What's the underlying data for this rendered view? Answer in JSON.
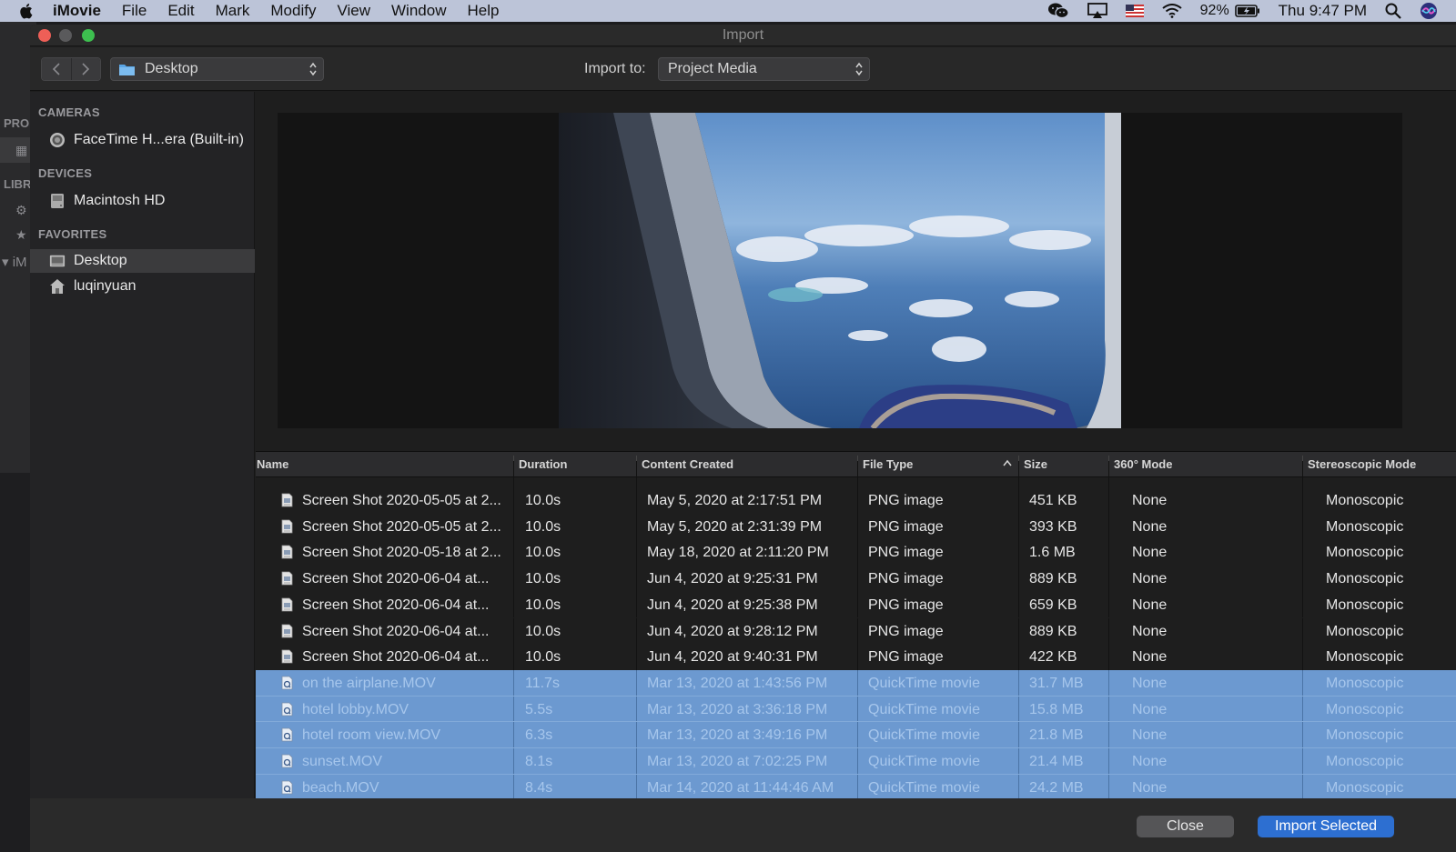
{
  "menubar": {
    "app_name": "iMovie",
    "menus": [
      "File",
      "Edit",
      "Mark",
      "Modify",
      "View",
      "Window",
      "Help"
    ],
    "battery": "92%",
    "clock": "Thu 9:47 PM"
  },
  "background_window": {
    "labels": [
      "PRO",
      "LIBR",
      "iM"
    ]
  },
  "window": {
    "title": "Import"
  },
  "toolbar": {
    "location": "Desktop",
    "import_to_label": "Import to:",
    "import_to_value": "Project Media"
  },
  "sidebar": {
    "cameras_header": "CAMERAS",
    "camera": "FaceTime H...era (Built-in)",
    "devices_header": "DEVICES",
    "device": "Macintosh HD",
    "favorites_header": "FAVORITES",
    "favorites": [
      "Desktop",
      "luqinyuan"
    ]
  },
  "preview": {
    "icon": "airplane-window-photo"
  },
  "table": {
    "columns": {
      "name": "Name",
      "duration": "Duration",
      "content_created": "Content Created",
      "file_type": "File Type",
      "size": "Size",
      "mode_360": "360° Mode",
      "stereo": "Stereoscopic Mode"
    },
    "rows": [
      {
        "name": "Screen Shot 2020-05-05 at 2...",
        "duration": "10.0s",
        "created": "May 5, 2020 at 2:17:51 PM",
        "type": "PNG image",
        "size": "451 KB",
        "mode360": "None",
        "stereo": "Monoscopic",
        "selected": false,
        "kind": "image"
      },
      {
        "name": "Screen Shot 2020-05-05 at 2...",
        "duration": "10.0s",
        "created": "May 5, 2020 at 2:31:39 PM",
        "type": "PNG image",
        "size": "393 KB",
        "mode360": "None",
        "stereo": "Monoscopic",
        "selected": false,
        "kind": "image"
      },
      {
        "name": "Screen Shot 2020-05-18 at 2...",
        "duration": "10.0s",
        "created": "May 18, 2020 at 2:11:20 PM",
        "type": "PNG image",
        "size": "1.6 MB",
        "mode360": "None",
        "stereo": "Monoscopic",
        "selected": false,
        "kind": "image"
      },
      {
        "name": "Screen Shot 2020-06-04 at...",
        "duration": "10.0s",
        "created": "Jun 4, 2020 at 9:25:31 PM",
        "type": "PNG image",
        "size": "889 KB",
        "mode360": "None",
        "stereo": "Monoscopic",
        "selected": false,
        "kind": "image"
      },
      {
        "name": "Screen Shot 2020-06-04 at...",
        "duration": "10.0s",
        "created": "Jun 4, 2020 at 9:25:38 PM",
        "type": "PNG image",
        "size": "659 KB",
        "mode360": "None",
        "stereo": "Monoscopic",
        "selected": false,
        "kind": "image"
      },
      {
        "name": "Screen Shot 2020-06-04 at...",
        "duration": "10.0s",
        "created": "Jun 4, 2020 at 9:28:12 PM",
        "type": "PNG image",
        "size": "889 KB",
        "mode360": "None",
        "stereo": "Monoscopic",
        "selected": false,
        "kind": "image"
      },
      {
        "name": "Screen Shot 2020-06-04 at...",
        "duration": "10.0s",
        "created": "Jun 4, 2020 at 9:40:31 PM",
        "type": "PNG image",
        "size": "422 KB",
        "mode360": "None",
        "stereo": "Monoscopic",
        "selected": false,
        "kind": "image"
      },
      {
        "name": "on the airplane.MOV",
        "duration": "11.7s",
        "created": "Mar 13, 2020 at 1:43:56 PM",
        "type": "QuickTime movie",
        "size": "31.7 MB",
        "mode360": "None",
        "stereo": "Monoscopic",
        "selected": true,
        "kind": "movie"
      },
      {
        "name": "hotel lobby.MOV",
        "duration": "5.5s",
        "created": "Mar 13, 2020 at 3:36:18 PM",
        "type": "QuickTime movie",
        "size": "15.8 MB",
        "mode360": "None",
        "stereo": "Monoscopic",
        "selected": true,
        "kind": "movie"
      },
      {
        "name": "hotel room view.MOV",
        "duration": "6.3s",
        "created": "Mar 13, 2020 at 3:49:16 PM",
        "type": "QuickTime movie",
        "size": "21.8 MB",
        "mode360": "None",
        "stereo": "Monoscopic",
        "selected": true,
        "kind": "movie"
      },
      {
        "name": "sunset.MOV",
        "duration": "8.1s",
        "created": "Mar 13, 2020 at 7:02:25 PM",
        "type": "QuickTime movie",
        "size": "21.4 MB",
        "mode360": "None",
        "stereo": "Monoscopic",
        "selected": true,
        "kind": "movie"
      },
      {
        "name": "beach.MOV",
        "duration": "8.4s",
        "created": "Mar 14, 2020 at 11:44:46 AM",
        "type": "QuickTime movie",
        "size": "24.2 MB",
        "mode360": "None",
        "stereo": "Monoscopic",
        "selected": true,
        "kind": "movie"
      }
    ]
  },
  "footer": {
    "close_label": "Close",
    "import_label": "Import Selected"
  },
  "colors": {
    "selection": "#6c99d0",
    "primary_button": "#2d6fd1",
    "close_light": "#ee5f57",
    "zoom_light": "#3dbf4f"
  }
}
